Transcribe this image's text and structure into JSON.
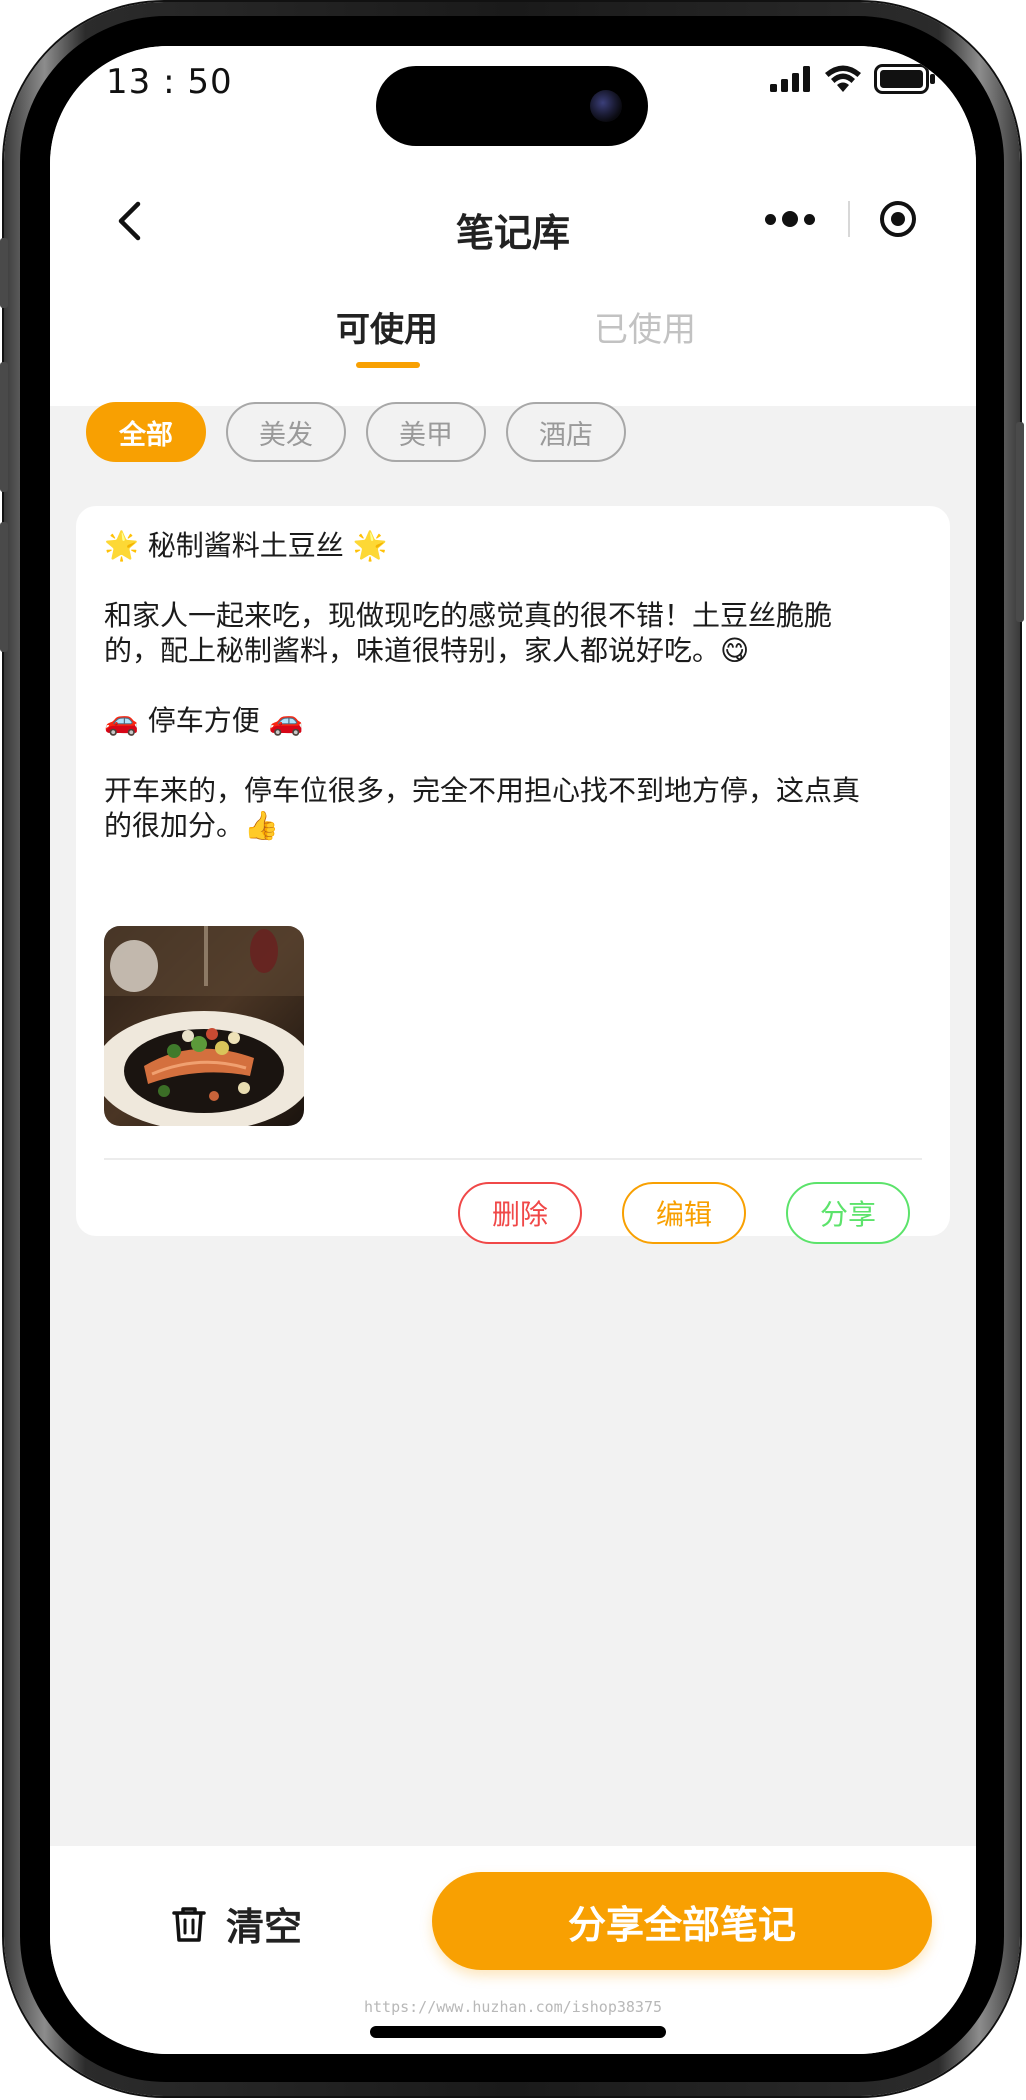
{
  "status_bar": {
    "time": "13 : 50"
  },
  "nav": {
    "title": "笔记库"
  },
  "tabs": [
    {
      "label": "可使用",
      "active": true
    },
    {
      "label": "已使用",
      "active": false
    }
  ],
  "categories": [
    {
      "label": "全部",
      "active": true
    },
    {
      "label": "美发",
      "active": false
    },
    {
      "label": "美甲",
      "active": false
    },
    {
      "label": "酒店",
      "active": false
    }
  ],
  "note": {
    "title": "🌟 秘制酱料土豆丝 🌟",
    "paragraph1": "和家人一起来吃，现做现吃的感觉真的很不错！土豆丝脆脆的，配上秘制酱料，味道很特别，家人都说好吃。😋",
    "subtitle": "🚗 停车方便 🚗",
    "paragraph2": "开车来的，停车位很多，完全不用担心找不到地方停，这点真的很加分。👍",
    "image": "salmon-dish-photo",
    "actions": {
      "delete": "删除",
      "edit": "编辑",
      "share": "分享"
    }
  },
  "bottom": {
    "clear_label": "清空",
    "share_all_label": "分享全部笔记",
    "watermark": "https://www.huzhan.com/ishop38375"
  },
  "colors": {
    "accent": "#f8a002",
    "delete": "#f04848",
    "share": "#5ce36b",
    "background": "#f2f2f2"
  }
}
